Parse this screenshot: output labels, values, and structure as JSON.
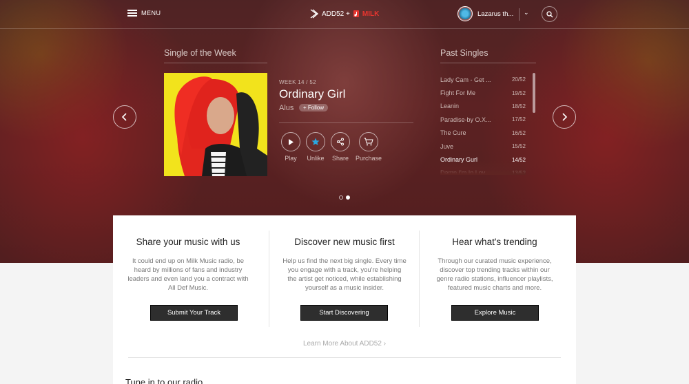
{
  "topbar": {
    "menu_label": "MENU",
    "logo_add52": "ADD52 +",
    "logo_milk": "MILK",
    "username": "Lazarus th...",
    "chevron": "⌄"
  },
  "single_of_week": {
    "heading": "Single of the Week",
    "week": "WEEK 14 / 52",
    "title": "Ordinary Girl",
    "artist": "Alus",
    "follow_label": "+ Follow",
    "actions": {
      "play": "Play",
      "unlike": "Unlike",
      "share": "Share",
      "purchase": "Purchase"
    }
  },
  "past_singles": {
    "heading": "Past Singles",
    "items": [
      {
        "title": "Lady Cam - Get ...",
        "week": "20/52"
      },
      {
        "title": "Fight For Me",
        "week": "19/52"
      },
      {
        "title": "Leanin",
        "week": "18/52"
      },
      {
        "title": "Paradise-by O.X...",
        "week": "17/52"
      },
      {
        "title": "The Cure",
        "week": "16/52"
      },
      {
        "title": "Juve",
        "week": "15/52"
      },
      {
        "title": "Ordinary Gurl",
        "week": "14/52"
      },
      {
        "title": "Damn I'm In Lov...",
        "week": "13/52"
      }
    ],
    "active_index": 6
  },
  "carousel": {
    "pages": 2,
    "active_page": 2
  },
  "info": {
    "columns": [
      {
        "title": "Share your music with us",
        "body": "It could end up on Milk Music radio, be heard by millions of fans and industry leaders and even land you a contract with All Def Music.",
        "button": "Submit Your Track"
      },
      {
        "title": "Discover new music first",
        "body": "Help us find the next big single. Every time you engage with a track, you're helping the artist get noticed, while establishing yourself as a music insider.",
        "button": "Start Discovering"
      },
      {
        "title": "Hear what's trending",
        "body": "Through our curated music experience, discover top trending tracks within our genre radio stations, influencer playlists, featured music charts and more.",
        "button": "Explore Music"
      }
    ],
    "learn_more": "Learn More About ADD52 ›",
    "radio_heading": "Tune in to our radio"
  },
  "colors": {
    "accent_star": "#2aa7e0",
    "milk_red": "#e8352f",
    "button_dark": "#2e2e2e"
  }
}
